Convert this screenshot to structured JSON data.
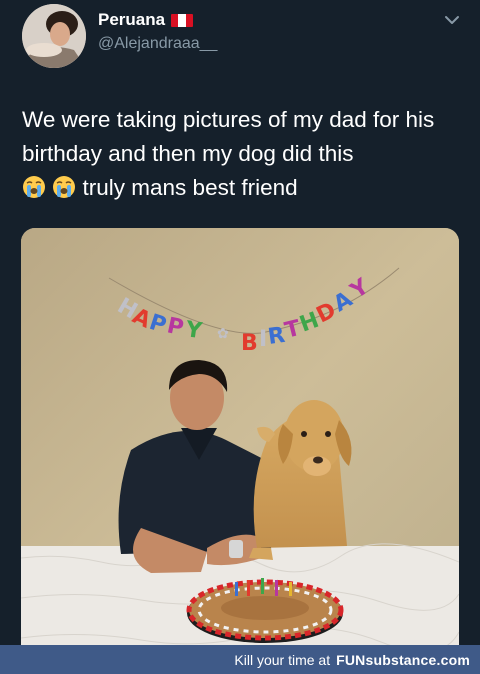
{
  "user": {
    "display_name": "Peruana",
    "handle": "@Alejandraaa__"
  },
  "tweet": {
    "text_before_emoji": "We were taking pictures of my dad for his birthday and then my dog did this",
    "emoji": [
      "loudly-crying-face",
      "loudly-crying-face"
    ],
    "text_after_emoji": "truly mans best friend"
  },
  "photo": {
    "banner_text": "HAPPY BIRTHDAY"
  },
  "footer": {
    "caption": "Kill your time at",
    "brand": "FUNsubstance.com"
  },
  "colors": {
    "background": "#15202b",
    "secondary_text": "#8899a6",
    "footer_bg": "#3f5a88",
    "flag_red": "#d91023",
    "flag_white": "#ffffff"
  }
}
